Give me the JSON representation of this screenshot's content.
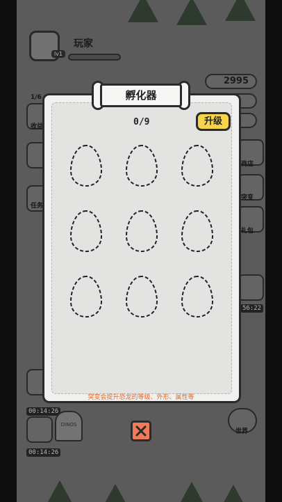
{
  "player": {
    "name": "玩家",
    "level": "lv1"
  },
  "currency": {
    "amount": "2995"
  },
  "background_labels": {
    "progress": "1/6",
    "collect": "收益",
    "task": "任务",
    "shop": "商店",
    "mutate": "突变",
    "gift": "礼包",
    "world": "世界",
    "gravestone": "DINOS",
    "timer1": "56:22",
    "timer2": "00:14:26",
    "timer3": "00:14:26"
  },
  "incubator": {
    "title": "孵化器",
    "count_text": "0/9",
    "upgrade_label": "升级",
    "hint": "突变会提升恐龙的等级、外形、属性等",
    "slots": [
      {
        "state": "empty"
      },
      {
        "state": "empty"
      },
      {
        "state": "empty"
      },
      {
        "state": "empty"
      },
      {
        "state": "empty"
      },
      {
        "state": "empty"
      },
      {
        "state": "empty"
      },
      {
        "state": "empty"
      },
      {
        "state": "empty"
      }
    ]
  },
  "colors": {
    "accent": "#f6d54a",
    "close": "#f07a5a",
    "hint": "#e26a2c"
  }
}
